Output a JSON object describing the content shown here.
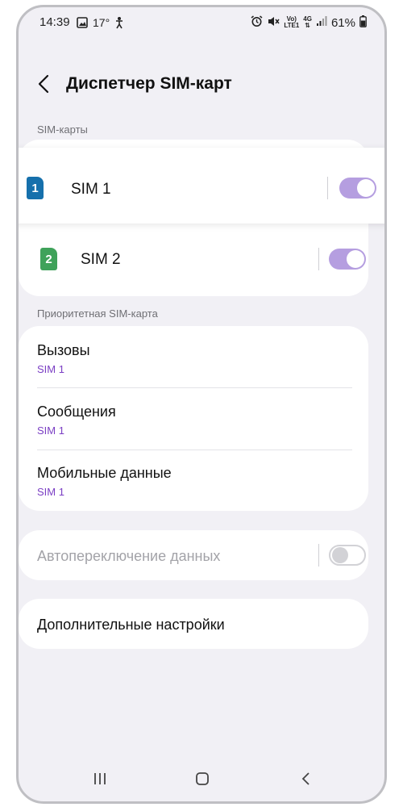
{
  "status_bar": {
    "time": "14:39",
    "temperature": "17°",
    "network_top": "Vo)",
    "network_bottom": "LTE1",
    "net_gen": "4G",
    "battery": "61%"
  },
  "header": {
    "title": "Диспетчер SIM-карт"
  },
  "sections": {
    "sim_cards": "SIM-карты",
    "priority": "Приоритетная SIM-карта"
  },
  "sims": [
    {
      "number": "1",
      "label": "SIM 1",
      "enabled": true,
      "color": "#1670ac"
    },
    {
      "number": "2",
      "label": "SIM 2",
      "enabled": true,
      "color": "#3fa25a"
    }
  ],
  "priority_items": [
    {
      "title": "Вызовы",
      "value": "SIM 1"
    },
    {
      "title": "Сообщения",
      "value": "SIM 1"
    },
    {
      "title": "Мобильные данные",
      "value": "SIM 1"
    }
  ],
  "auto_switch": {
    "label": "Автопереключение данных",
    "enabled": false
  },
  "more_settings": {
    "label": "Дополнительные настройки"
  },
  "colors": {
    "accent": "#7b3fc4",
    "toggle_on": "#b59ee0",
    "background": "#f1f0f5"
  }
}
